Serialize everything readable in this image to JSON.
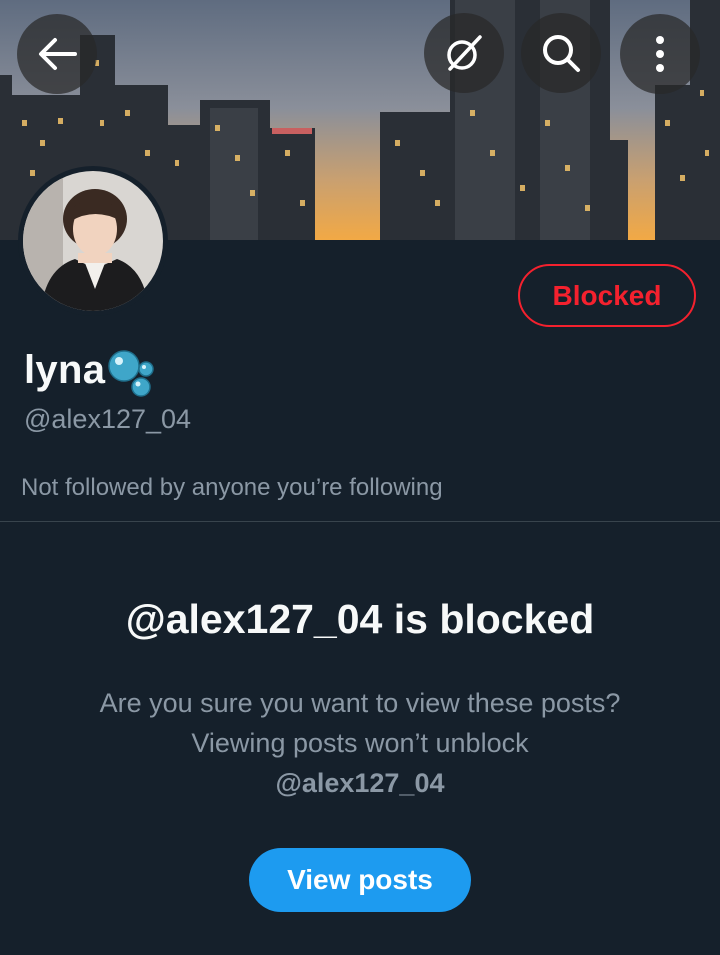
{
  "header": {
    "back_icon": "arrow-left-icon",
    "grok_icon": "grok-icon",
    "search_icon": "search-icon",
    "more_icon": "more-vertical-icon"
  },
  "profile": {
    "display_name": "lyna",
    "name_emoji": "bubbles-icon",
    "handle": "@alex127_04",
    "followers_note": "Not followed by anyone you’re following",
    "block_status_label": "Blocked"
  },
  "blocked_notice": {
    "title": "@alex127_04 is blocked",
    "description": "Are you sure you want to view these posts? Viewing posts won’t unblock",
    "description_handle": "@alex127_04",
    "view_posts_label": "View posts"
  },
  "colors": {
    "background": "#15202b",
    "accent_blue": "#1d9bf0",
    "blocked_red": "#f4212e",
    "secondary_text": "#8b98a5",
    "divider": "#38444d"
  }
}
